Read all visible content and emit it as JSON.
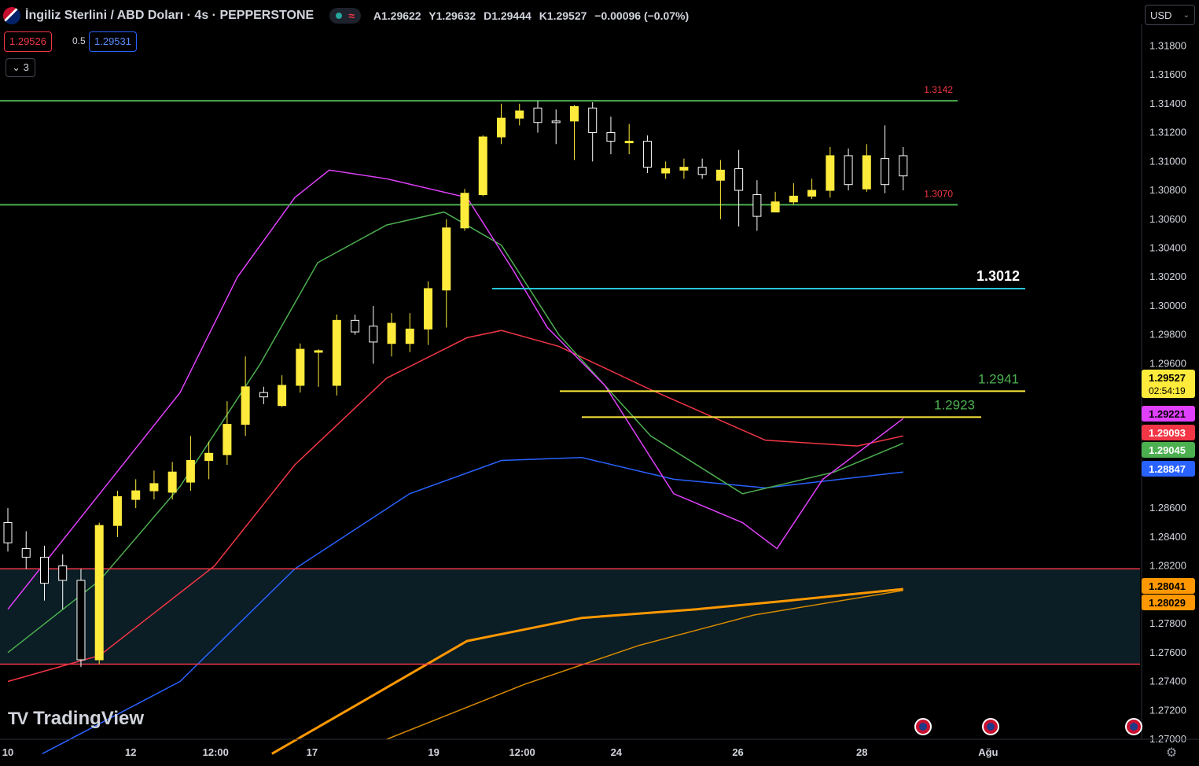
{
  "header": {
    "title": "İngiliz Sterlini / ABD Doları · 4s · PEPPERSTONE",
    "ohlc": {
      "open": "A1.29622",
      "high": "Y1.29632",
      "low": "D1.29444",
      "close": "K1.29527",
      "change": "−0.00096 (−0.07%)"
    }
  },
  "trade": {
    "sell": "1.29526",
    "spread": "0.5",
    "buy": "1.29531"
  },
  "indicator_toggle": "3",
  "currency": "USD",
  "brand": "TradingView",
  "colors": {
    "candle_up": "#ffeb3b",
    "candle_down": "#ffffff",
    "bg": "#000000",
    "zone": "#0b1d25"
  },
  "chart_data": {
    "type": "candlestick",
    "symbol": "GBPUSD",
    "timeframe": "4s",
    "ylim": [
      1.27,
      1.319
    ],
    "y_ticks": [
      "1.31800",
      "1.31600",
      "1.31400",
      "1.31200",
      "1.31000",
      "1.30800",
      "1.30600",
      "1.30400",
      "1.30200",
      "1.30000",
      "1.29800",
      "1.29600",
      "1.28600",
      "1.28400",
      "1.28200",
      "1.27800",
      "1.27600",
      "1.27400",
      "1.27200",
      "1.27000"
    ],
    "x_ticks": [
      {
        "label": "10",
        "i": 0
      },
      {
        "label": "12",
        "i": 10.7
      },
      {
        "label": "12:00",
        "i": 18.1
      },
      {
        "label": "17",
        "i": 26.5
      },
      {
        "label": "19",
        "i": 37.1
      },
      {
        "label": "12:00",
        "i": 44.8
      },
      {
        "label": "24",
        "i": 53.0
      },
      {
        "label": "26",
        "i": 63.6
      },
      {
        "label": "28",
        "i": 74.4
      },
      {
        "label": "Ağu",
        "i": 85.4
      }
    ],
    "candles": [
      [
        1.285,
        1.2836,
        1.286,
        1.283
      ],
      [
        1.2832,
        1.2826,
        1.2844,
        1.2818
      ],
      [
        1.2826,
        1.2808,
        1.2834,
        1.2796
      ],
      [
        1.282,
        1.281,
        1.2828,
        1.279
      ],
      [
        1.281,
        1.2755,
        1.2818,
        1.275
      ],
      [
        1.2755,
        1.2848,
        1.285,
        1.2752
      ],
      [
        1.2848,
        1.2868,
        1.2872,
        1.284
      ],
      [
        1.2866,
        1.2872,
        1.288,
        1.286
      ],
      [
        1.2872,
        1.2877,
        1.2886,
        1.2866
      ],
      [
        1.2871,
        1.2885,
        1.2892,
        1.2866
      ],
      [
        1.2878,
        1.2893,
        1.291,
        1.2872
      ],
      [
        1.2893,
        1.2898,
        1.2906,
        1.288
      ],
      [
        1.2897,
        1.2918,
        1.2934,
        1.289
      ],
      [
        1.2918,
        1.2944,
        1.2965,
        1.291
      ],
      [
        1.294,
        1.2937,
        1.2944,
        1.2932
      ],
      [
        1.2931,
        1.2945,
        1.2952,
        1.293
      ],
      [
        1.2945,
        1.297,
        1.2974,
        1.294
      ],
      [
        1.2968,
        1.2969,
        1.297,
        1.2944
      ],
      [
        1.2945,
        1.299,
        1.2994,
        1.2938
      ],
      [
        1.299,
        1.2982,
        1.2994,
        1.298
      ],
      [
        1.2986,
        1.2975,
        1.3,
        1.296
      ],
      [
        1.2974,
        1.2988,
        1.2995,
        1.2965
      ],
      [
        1.2974,
        1.2984,
        1.2995,
        1.2968
      ],
      [
        1.2984,
        1.3012,
        1.3017,
        1.2973
      ],
      [
        1.3011,
        1.3054,
        1.306,
        1.2985
      ],
      [
        1.3054,
        1.3078,
        1.3081,
        1.3052
      ],
      [
        1.3077,
        1.3117,
        1.3118,
        1.3076
      ],
      [
        1.3117,
        1.313,
        1.314,
        1.3112
      ],
      [
        1.313,
        1.3135,
        1.314,
        1.3125
      ],
      [
        1.3137,
        1.3127,
        1.3142,
        1.312
      ],
      [
        1.3128,
        1.3127,
        1.3136,
        1.3112
      ],
      [
        1.3128,
        1.3138,
        1.3139,
        1.3101
      ],
      [
        1.3137,
        1.312,
        1.3141,
        1.31
      ],
      [
        1.312,
        1.3114,
        1.3131,
        1.3105
      ],
      [
        1.3114,
        1.3114,
        1.3126,
        1.3105
      ],
      [
        1.3114,
        1.3096,
        1.3118,
        1.3092
      ],
      [
        1.3092,
        1.3095,
        1.31,
        1.3088
      ],
      [
        1.3094,
        1.3096,
        1.3102,
        1.3088
      ],
      [
        1.3096,
        1.3091,
        1.3102,
        1.3088
      ],
      [
        1.3087,
        1.3094,
        1.3101,
        1.306
      ],
      [
        1.3095,
        1.308,
        1.3108,
        1.3055
      ],
      [
        1.3077,
        1.3062,
        1.3087,
        1.3052
      ],
      [
        1.3065,
        1.3072,
        1.3079,
        1.3068
      ],
      [
        1.3072,
        1.3076,
        1.3085,
        1.307
      ],
      [
        1.3076,
        1.308,
        1.3088,
        1.3074
      ],
      [
        1.308,
        1.3104,
        1.311,
        1.3075
      ],
      [
        1.3104,
        1.3084,
        1.3109,
        1.308
      ],
      [
        1.3081,
        1.3104,
        1.3112,
        1.3079
      ],
      [
        1.3102,
        1.3084,
        1.3125,
        1.3078
      ],
      [
        1.3104,
        1.309,
        1.311,
        1.308
      ]
    ],
    "levels": [
      {
        "price": 1.3142,
        "label": "1.3142",
        "color": "#4caf50",
        "label_color": "#f23645"
      },
      {
        "price": 1.307,
        "label": "1.3070",
        "color": "#4caf50",
        "label_color": "#f23645"
      },
      {
        "price": 1.3012,
        "label": "1.3012",
        "color": "#26c6da",
        "label_color": "#ffffff"
      },
      {
        "price": 1.2941,
        "label": "1.2941",
        "color": "#ffeb3b",
        "label_color": "#4caf50"
      },
      {
        "price": 1.2923,
        "label": "1.2923",
        "color": "#ffeb3b",
        "label_color": "#4caf50"
      },
      {
        "price": 1.2818,
        "label": "",
        "color": "#f23645",
        "label_color": ""
      },
      {
        "price": 1.2752,
        "label": "",
        "color": "#f23645",
        "label_color": ""
      }
    ],
    "price_tags": [
      {
        "value": "1.29527",
        "sub": "02:54:19",
        "bg": "#ffeb3b",
        "fg": "#000000"
      },
      {
        "value": "1.29221",
        "bg": "#e040fb",
        "fg": "#000000"
      },
      {
        "value": "1.29093",
        "bg": "#f23645",
        "fg": "#ffffff"
      },
      {
        "value": "1.29045",
        "bg": "#4caf50",
        "fg": "#ffffff"
      },
      {
        "value": "1.28847",
        "bg": "#2962ff",
        "fg": "#ffffff"
      },
      {
        "value": "1.28041",
        "bg": "#ff9800",
        "fg": "#000000"
      },
      {
        "value": "1.28029",
        "bg": "#ff9800",
        "fg": "#000000"
      }
    ]
  }
}
